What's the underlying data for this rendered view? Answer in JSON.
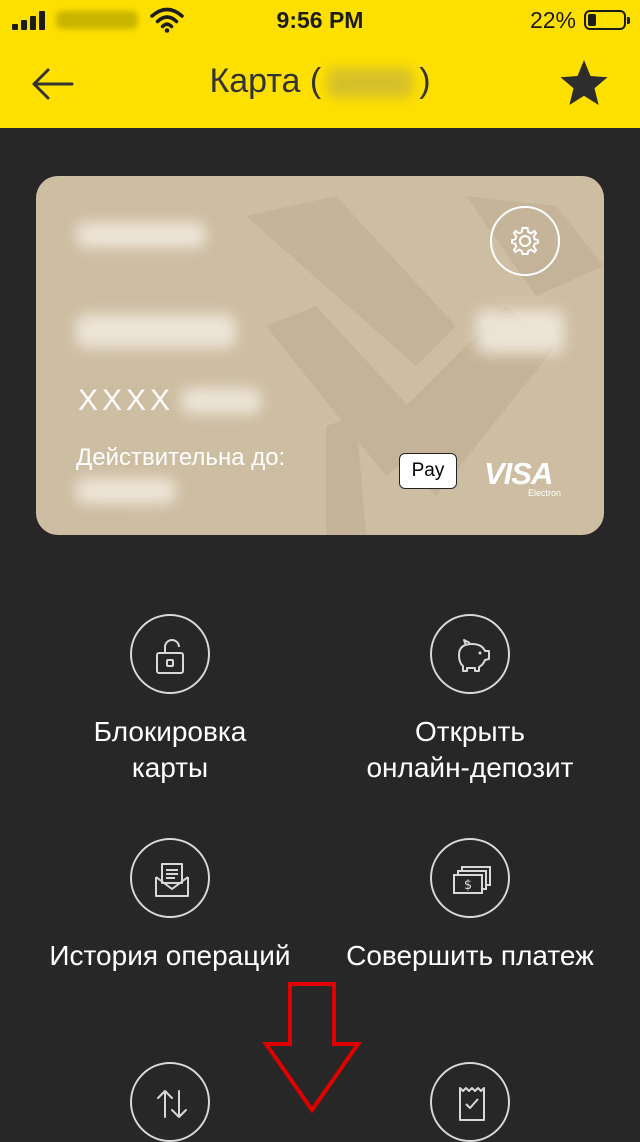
{
  "status_bar": {
    "time": "9:56 PM",
    "battery_percent": "22%",
    "battery_level": 0.22
  },
  "header": {
    "title": "Карта (",
    "title_suffix": ")",
    "back_icon": "arrow-left-icon",
    "favorite_icon": "star-icon"
  },
  "card": {
    "masked_number": "XXXX",
    "valid_until_label": "Действительна до:",
    "apple_pay_label": "Pay",
    "visa_label": "VISA",
    "visa_sub_label": "Electron",
    "settings_icon": "gear-icon",
    "background_color": "#cdbda2"
  },
  "actions": [
    {
      "label_1": "Блокировка",
      "label_2": "карты",
      "icon": "padlock-icon"
    },
    {
      "label_1": "Открыть",
      "label_2": "онлайн-депозит",
      "icon": "piggy-bank-icon"
    },
    {
      "label_1": "История операций",
      "label_2": "",
      "icon": "envelope-history-icon"
    },
    {
      "label_1": "Совершить платеж",
      "label_2": "",
      "icon": "money-stack-icon"
    },
    {
      "label_1": "",
      "label_2": "",
      "icon": "transfer-arrows-icon"
    },
    {
      "label_1": "",
      "label_2": "",
      "icon": "receipt-check-icon"
    }
  ],
  "colors": {
    "header_yellow": "#FEE000",
    "background": "#272727",
    "annotation_arrow": "#e00000"
  }
}
